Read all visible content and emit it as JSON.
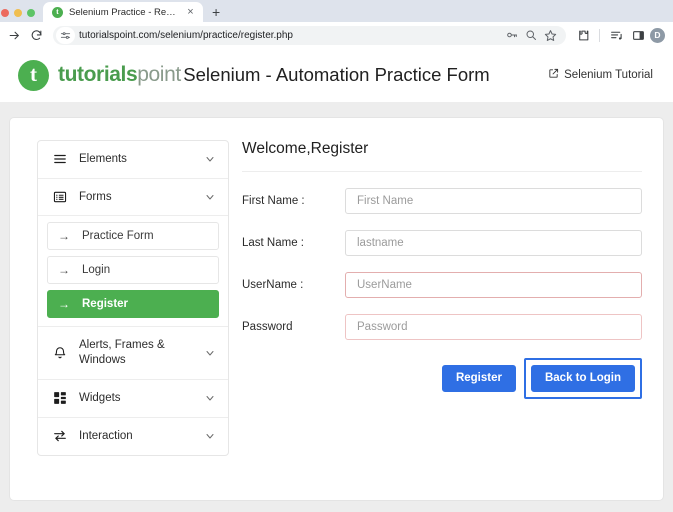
{
  "browser": {
    "window_controls": [
      "close",
      "minimize",
      "maximize"
    ],
    "tab": {
      "title": "Selenium Practice - Register",
      "favicon_letter": "t",
      "close_label": "×"
    },
    "new_tab_label": "+",
    "toolbar": {
      "forward_icon": "forward-arrow-icon",
      "reload_icon": "reload-icon",
      "site_settings_icon": "tune-icon",
      "url": "tutorialspoint.com/selenium/practice/register.php",
      "password_icon": "key-icon",
      "search_icon": "magnifier-icon",
      "bookmark_icon": "star-icon",
      "extensions_icon": "puzzle-icon",
      "reading_list_icon": "reading-list-icon",
      "side_panel_icon": "side-panel-icon",
      "profile_initial": "D"
    }
  },
  "site": {
    "logo": {
      "mark_letter": "t",
      "word_bold": "tutorials",
      "word_light": "point"
    },
    "page_title": "Selenium - Automation Practice Form",
    "header_link": {
      "label": "Selenium Tutorial",
      "icon": "external-link-icon"
    }
  },
  "sidebar": {
    "groups": [
      {
        "label": "Elements",
        "icon": "hamburger-icon",
        "chevron": "chevron-down-icon",
        "expanded": false
      },
      {
        "label": "Forms",
        "icon": "list-box-icon",
        "chevron": "chevron-down-icon",
        "expanded": true
      },
      {
        "label": "Alerts, Frames & Windows",
        "icon": "bell-icon",
        "chevron": "chevron-down-icon",
        "expanded": false
      },
      {
        "label": "Widgets",
        "icon": "widgets-grid-icon",
        "chevron": "chevron-down-icon",
        "expanded": false
      },
      {
        "label": "Interaction",
        "icon": "exchange-arrows-icon",
        "chevron": "chevron-down-icon",
        "expanded": false
      }
    ],
    "forms_items": [
      {
        "label": "Practice Form",
        "arrow": "→",
        "active": false
      },
      {
        "label": "Login",
        "arrow": "→",
        "active": false
      },
      {
        "label": "Register",
        "arrow": "→",
        "active": true
      }
    ]
  },
  "form": {
    "heading": "Welcome,Register",
    "fields": [
      {
        "label": "First Name :",
        "value": "",
        "placeholder": "First Name",
        "state": "normal"
      },
      {
        "label": "Last Name :",
        "value": "",
        "placeholder": "lastname",
        "state": "normal"
      },
      {
        "label": "UserName :",
        "value": "",
        "placeholder": "UserName",
        "state": "invalid"
      },
      {
        "label": "Password",
        "value": "",
        "placeholder": "Password",
        "state": "invalid-soft"
      }
    ],
    "buttons": {
      "register": "Register",
      "back_to_login": "Back to Login"
    }
  },
  "colors": {
    "brand_green": "#4caf50",
    "button_blue": "#2f6fe4",
    "invalid_border": "#e3aeae",
    "page_background": "#ededed"
  }
}
